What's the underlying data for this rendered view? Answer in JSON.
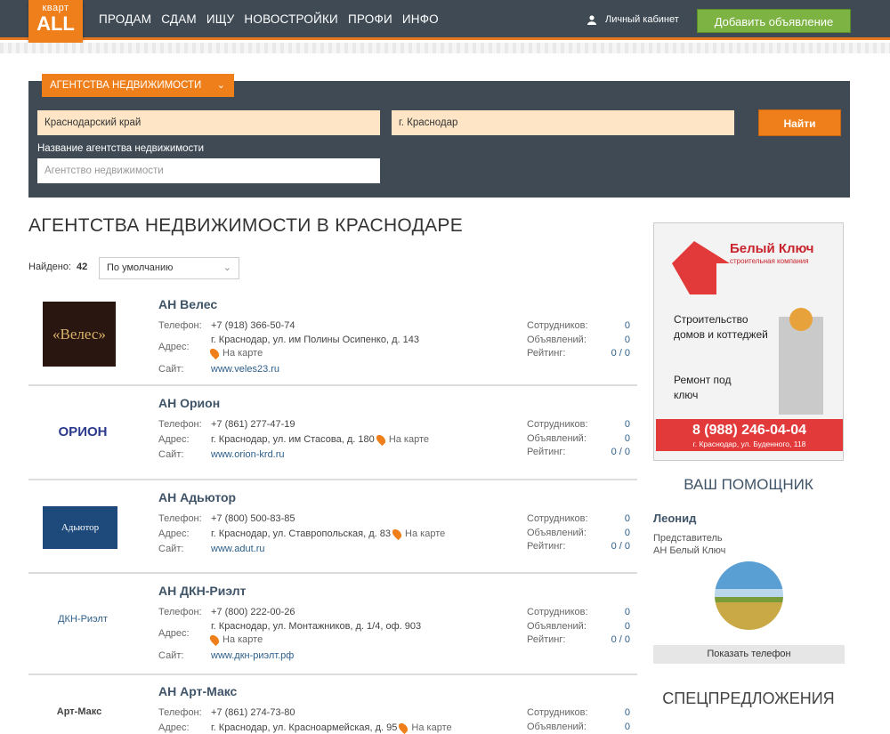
{
  "header": {
    "logo_top": "кварт",
    "logo_main": "ALL",
    "nav": [
      "ПРОДАМ",
      "СДАМ",
      "ИЩУ",
      "НОВОСТРОЙКИ",
      "ПРОФИ",
      "ИНФО"
    ],
    "cabinet": "Личный кабинет",
    "add_button": "Добавить объявление"
  },
  "search": {
    "category": "АГЕНТСТВА НЕДВИЖИМОСТИ",
    "region": "Краснодарский край",
    "city": "г. Краснодар",
    "find_button": "Найти",
    "name_label": "Название агентства недвижимости",
    "name_placeholder": "Агентство недвижимости"
  },
  "page_title": "АГЕНТСТВА НЕДВИЖИМОСТИ В КРАСНОДАРЕ",
  "found_label": "Найдено:",
  "found_count": "42",
  "sort_value": "По умолчанию",
  "labels": {
    "phone": "Телефон:",
    "address": "Адрес:",
    "site": "Сайт:",
    "on_map": "На карте",
    "employees": "Сотрудников:",
    "ads": "Объявлений:",
    "rating": "Рейтинг:"
  },
  "agencies": [
    {
      "name": "АН Велес",
      "logo": "«Велес»",
      "phone": "+7 (918) 366-50-74",
      "address": "г. Краснодар, ул. им Полины Осипенко, д. 143",
      "site": "www.veles23.ru",
      "employees": "0",
      "ads": "0",
      "rating": "0 / 0"
    },
    {
      "name": "АН Орион",
      "logo": "ОРИОН",
      "phone": "+7 (861) 277-47-19",
      "address": "г. Краснодар, ул. им Стасова, д. 180",
      "site": "www.orion-krd.ru",
      "employees": "0",
      "ads": "0",
      "rating": "0 / 0"
    },
    {
      "name": "АН Адьютор",
      "logo": "Адьютор",
      "phone": "+7 (800) 500-83-85",
      "address": "г. Краснодар, ул. Ставропольская, д. 83",
      "site": "www.adut.ru",
      "employees": "0",
      "ads": "0",
      "rating": "0 / 0"
    },
    {
      "name": "АН ДКН-Риэлт",
      "logo": "ДКН-Риэлт",
      "phone": "+7 (800) 222-00-26",
      "address": "г. Краснодар, ул. Монтажников, д. 1/4, оф. 903",
      "site": "www.дкн-риэлт.рф",
      "employees": "0",
      "ads": "0",
      "rating": "0 / 0"
    },
    {
      "name": "АН Арт-Макс",
      "logo": "Арт-Макс",
      "phone": "+7 (861) 274-73-80",
      "address": "г. Краснодар, ул. Красноармейская, д. 95",
      "site": "",
      "employees": "0",
      "ads": "0",
      "rating": ""
    }
  ],
  "banner": {
    "brand": "Белый Ключ",
    "brand_sub": "строительная компания",
    "text1": "Строительство домов и коттеджей",
    "text2": "Ремонт под ключ",
    "phone": "8 (988) 246-04-04",
    "address": "г. Краснодар, ул. Буденного, 118"
  },
  "helper": {
    "title": "ВАШ ПОМОЩНИК",
    "name": "Леонид",
    "role": "Представитель",
    "company": "АН Белый Ключ",
    "phone_button": "Показать телефон"
  },
  "special": "СПЕЦПРЕДЛОЖЕНИЯ"
}
